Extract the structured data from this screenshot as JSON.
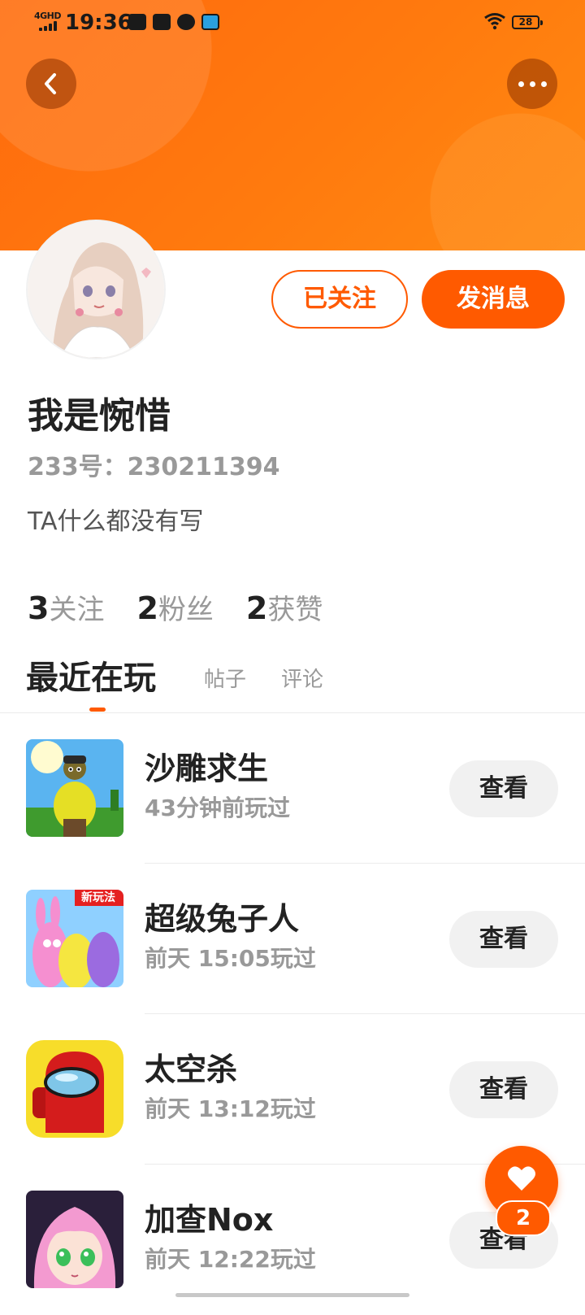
{
  "status_bar": {
    "network": "4GHD",
    "time": "19:36",
    "battery": "28"
  },
  "header": {
    "back_icon": "chevron-left-icon",
    "more_icon": "more-dots-icon",
    "gradient_colors": [
      "#ff6a0d",
      "#ff8a12"
    ]
  },
  "profile": {
    "name": "我是惋惜",
    "uid": "233号：230211394",
    "bio": "TA什么都没有写",
    "follow_label": "已关注",
    "message_label": "发消息",
    "accent_color": "#ff5a00"
  },
  "stats": [
    {
      "count": "3",
      "label": "关注"
    },
    {
      "count": "2",
      "label": "粉丝"
    },
    {
      "count": "2",
      "label": "获赞"
    }
  ],
  "tabs": {
    "active": "最近在玩",
    "posts": "帖子",
    "comments": "评论"
  },
  "games": [
    {
      "name": "沙雕求生",
      "played": "43分钟前玩过",
      "action": "查看",
      "icon": "sand-sculpture-survival-icon"
    },
    {
      "name": "超级兔子人",
      "played": "前天 15:05玩过",
      "action": "查看",
      "icon": "super-bunny-man-icon",
      "badge": "新玩法"
    },
    {
      "name": "太空杀",
      "played": "前天 13:12玩过",
      "action": "查看",
      "icon": "space-crewmate-icon"
    },
    {
      "name": "加查Nox",
      "played": "前天 12:22玩过",
      "action": "查看",
      "icon": "gacha-nox-icon"
    }
  ],
  "fab": {
    "icon": "heart-icon",
    "count": "2"
  }
}
